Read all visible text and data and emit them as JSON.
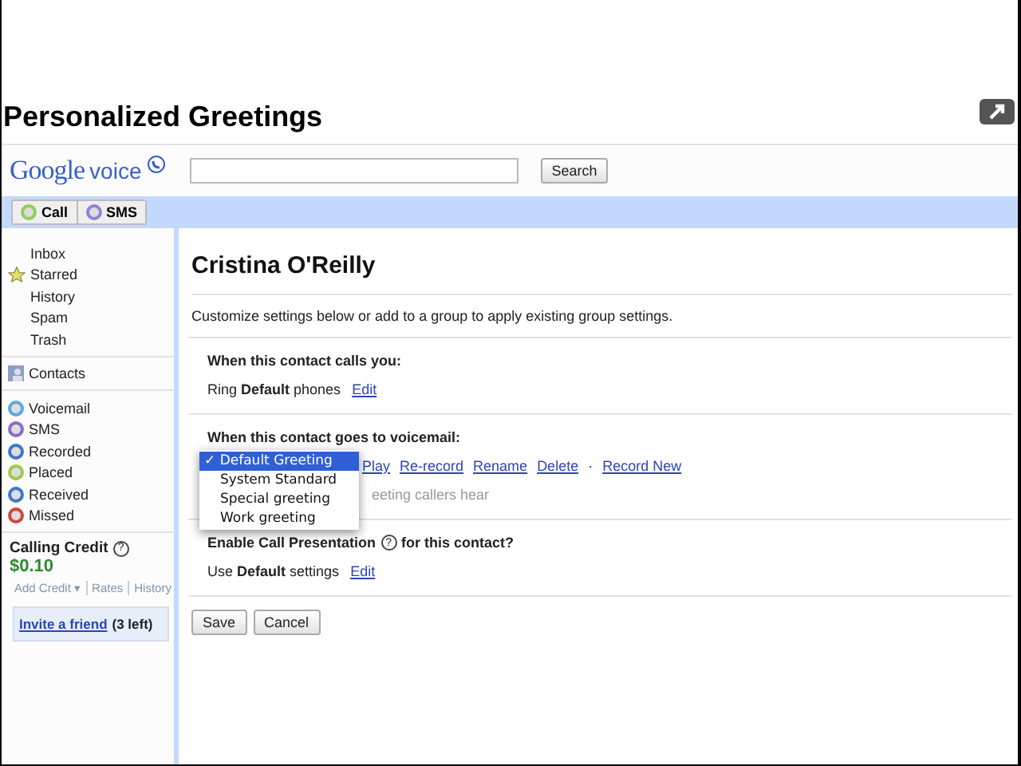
{
  "header": {
    "title": "Personalized Greetings"
  },
  "logo": {
    "brand": "Google",
    "product": "voice"
  },
  "search": {
    "button": "Search"
  },
  "actions": [
    {
      "label": "Call",
      "color": "#8fcf5a"
    },
    {
      "label": "SMS",
      "color": "#8e84d6"
    }
  ],
  "sidebar": {
    "folders": [
      {
        "label": "Inbox",
        "kind": "plain"
      },
      {
        "label": "Starred",
        "kind": "star"
      },
      {
        "label": "History",
        "kind": "plain"
      },
      {
        "label": "Spam",
        "kind": "plain"
      },
      {
        "label": "Trash",
        "kind": "plain"
      }
    ],
    "contacts": "Contacts",
    "filters": [
      {
        "label": "Voicemail",
        "color": "#5fa8e0"
      },
      {
        "label": "SMS",
        "color": "#8a6cc9"
      },
      {
        "label": "Recorded",
        "color": "#3c78c8"
      },
      {
        "label": "Placed",
        "color": "#9ccc4a"
      },
      {
        "label": "Received",
        "color": "#3c78c8"
      },
      {
        "label": "Missed",
        "color": "#d0463a"
      }
    ],
    "credit": {
      "title": "Calling Credit",
      "help": "?",
      "amount": "$0.10",
      "links": [
        "Add Credit ▾",
        "Rates",
        "History"
      ]
    },
    "invite": {
      "link": "Invite a friend",
      "note": "(3 left)"
    }
  },
  "contact": {
    "name": "Cristina O'Reilly",
    "description": "Customize settings below or add to a group to apply existing group settings.",
    "calls_section": {
      "heading": "When this contact calls you:",
      "text": "Ring **Default** phones",
      "link": "Edit"
    },
    "voicemail_section": {
      "heading": "When this contact goes to voicemail:",
      "mark": "✓",
      "menu": [
        {
          "label": "Default Greeting",
          "selected": true
        },
        {
          "label": "System Standard",
          "selected": false
        },
        {
          "label": "Special greeting",
          "selected": false
        },
        {
          "label": "Work greeting",
          "selected": false
        }
      ],
      "links": [
        "Play",
        "Re-record",
        "Rename",
        "Delete"
      ],
      "separator": "·",
      "record_link": "Record New",
      "hint": "eeting callers hear"
    },
    "presentation_section": {
      "heading": "Enable Call Presentation",
      "help": "?",
      "suffix": "for this contact?",
      "text": "Use **Default** settings",
      "link": "Edit"
    },
    "buttons": [
      "Save",
      "Cancel"
    ]
  }
}
